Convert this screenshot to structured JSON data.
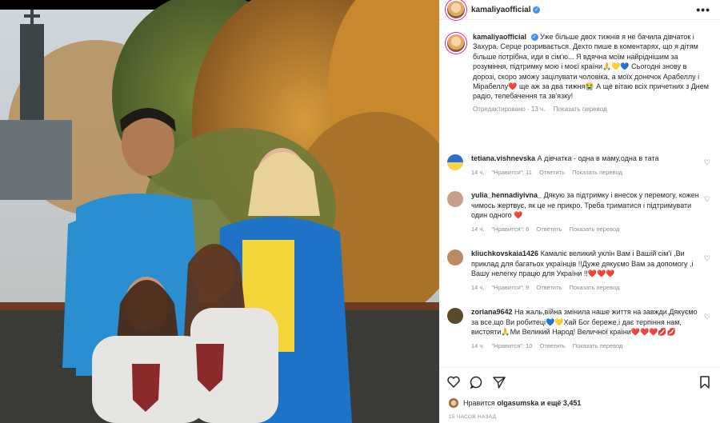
{
  "post": {
    "username": "kamaliyaofficial",
    "verified_icon": "verified-badge-icon",
    "more_label": "•••"
  },
  "caption": {
    "username": "kamaliyaofficial",
    "text": "Уже більше двох тижнів я не бачила дівчаток і Захура. Серце розривається. Дехто пише в коментарях, що я дітям більше потрібна, иди в сім'ю... Я вдячна моїм найріднішим за розуміння, підтримку мою і моєї країни🙏💛💙 Сьогодні знову в дорозі, скоро зможу зацілувати чоловіка, а моїх донечок Арабеллу і Мірабеллу❤️ ще аж за два тижня😭 А ще вітаю всіх причетних з Днем радіо, телебачення та зв'язку!",
    "edited": "Отредактировано · 13 ч.",
    "translate": "Показать перевод"
  },
  "comments": [
    {
      "username": "tetiana.vishnevska",
      "text": "А дівчатка - одна в маму,одна в тата",
      "time": "14 ч.",
      "likes": "\"Нравится\": 11",
      "reply": "Ответить",
      "translate": "Показать перевод",
      "avatar_color": "#f5d547"
    },
    {
      "username": "yulia_hennadiyivna_",
      "text": "Дякую за підтримку і внесок у перемогу, кожен чимось жертвує, як це не прикро. Треба триматися і підтримувати один одного ❤️",
      "time": "14 ч.",
      "likes": "\"Нравится\": 6",
      "reply": "Ответить",
      "translate": "Показать перевод",
      "avatar_color": "#c9a08a"
    },
    {
      "username": "kliuchkovskaia1426",
      "text": "Камаліє великий уклін Вам і Вашій сім'ї ,Ви приклад для багатьох українців !!Дуже дякуємо Вам за допомогу ,і Вашу нелегку працю для України !!❤️❤️❤️",
      "time": "14 ч.",
      "likes": "\"Нравится\": 9",
      "reply": "Ответить",
      "translate": "Показать перевод",
      "avatar_color": "#b98a63"
    },
    {
      "username": "zoriana9642",
      "text": "На жаль,війна змінила наше життя на завжди.Дякуємо за все,що Ви робитеці💙💛Хай Бог береже,і дає терпіння нам, вистояти🙏Ми Великий Народ! Величної країни❤️❤️❤️💋💋",
      "time": "14 ч.",
      "likes": "\"Нравится\": 10",
      "reply": "Ответить",
      "translate": "Показать перевод",
      "avatar_color": "#5a4a2a"
    }
  ],
  "actions": {
    "like_icon": "heart-outline-icon",
    "comment_icon": "comment-bubble-icon",
    "share_icon": "paper-plane-icon",
    "save_icon": "bookmark-icon"
  },
  "likes": {
    "prefix": "Нравится",
    "user": "olgasumska",
    "suffix": "и ещё 3,451"
  },
  "timestamp": "15 ЧАСОВ НАЗАД"
}
